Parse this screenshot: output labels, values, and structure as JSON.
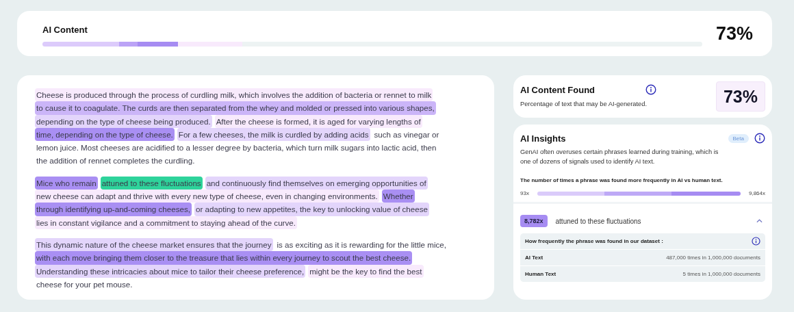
{
  "summary": {
    "title": "AI Content",
    "percent": "73%"
  },
  "document": {
    "paragraphs": [
      {
        "lines": [
          [
            {
              "text": "Cheese is produced through the process of curdling milk, which involves the addition of bacteria or rennet to milk",
              "kind": "light"
            }
          ],
          [
            {
              "text": "to cause it to coagulate. The curds are then separated from the whey and molded or pressed into various shapes,",
              "kind": "medium"
            }
          ],
          [
            {
              "text": "depending on the type of cheese being produced.",
              "kind": "soft"
            },
            {
              "text": "After the cheese is formed, it is aged for varying lengths of",
              "kind": "light"
            }
          ],
          [
            {
              "text": "time, depending on the type of cheese.",
              "kind": "strong"
            },
            {
              "text": "For a few cheeses, the milk is curdled by adding acids",
              "kind": "soft"
            },
            {
              "text": "such as vinegar or",
              "kind": "none"
            }
          ],
          [
            {
              "text": "lemon juice. Most cheeses are acidified to a lesser degree by bacteria, which turn milk sugars into lactic acid, then",
              "kind": "none"
            }
          ],
          [
            {
              "text": "the addition of rennet completes the curdling.",
              "kind": "none"
            }
          ]
        ]
      },
      {
        "lines": [
          [
            {
              "text": "Mice who remain",
              "kind": "strong"
            },
            {
              "text": "attuned to these fluctuations",
              "kind": "match"
            },
            {
              "text": "and continuously find themselves on emerging opportunities of",
              "kind": "soft"
            }
          ],
          [
            {
              "text": "new cheese can adapt and thrive with every new type of cheese, even in changing environments.",
              "kind": "light"
            },
            {
              "text": "Whether",
              "kind": "strong"
            }
          ],
          [
            {
              "text": "through identifying up-and-coming cheeses,",
              "kind": "strong"
            },
            {
              "text": "or adapting to new appetites, the key to unlocking value of cheese",
              "kind": "soft"
            }
          ],
          [
            {
              "text": "lies in constant vigilance and a commitment to staying ahead of the curve.",
              "kind": "light"
            }
          ]
        ]
      },
      {
        "lines": [
          [
            {
              "text": "This dynamic nature of the cheese market ensures that the journey",
              "kind": "soft"
            },
            {
              "text": "is as exciting as it is rewarding for the little mice,",
              "kind": "none"
            }
          ],
          [
            {
              "text": "with each move bringing them closer to the treasure that lies within every journey to scout the best cheese.",
              "kind": "strong"
            }
          ],
          [
            {
              "text": "Understanding these intricacies about mice to tailor their cheese preference,",
              "kind": "soft"
            },
            {
              "text": "might be the key to find the best",
              "kind": "light"
            }
          ],
          [
            {
              "text": "cheese for your pet mouse.",
              "kind": "none"
            }
          ]
        ]
      }
    ]
  },
  "found": {
    "title": "AI Content Found",
    "description": "Percentage of text that may be AI-generated.",
    "percent": "73%"
  },
  "insights": {
    "title": "AI Insights",
    "badge": "Beta",
    "description": "GenAI often overuses certain phrases learned during training, which is one of dozens of signals used to identify AI text.",
    "scale_caption": "The number of times a phrase was found more frequently in AI vs human text.",
    "scale_min": "93x",
    "scale_max": "9,864x",
    "phrase": {
      "count": "8,782x",
      "text": "attuned to these fluctuations",
      "expanded": true,
      "table_title": "How frequently the phrase was found in our dataset :",
      "rows": [
        {
          "label": "AI Text",
          "value": "487,000 times in 1,000,000 documents"
        },
        {
          "label": "Human Text",
          "value": "5 times in 1,000,000 documents"
        }
      ]
    }
  }
}
